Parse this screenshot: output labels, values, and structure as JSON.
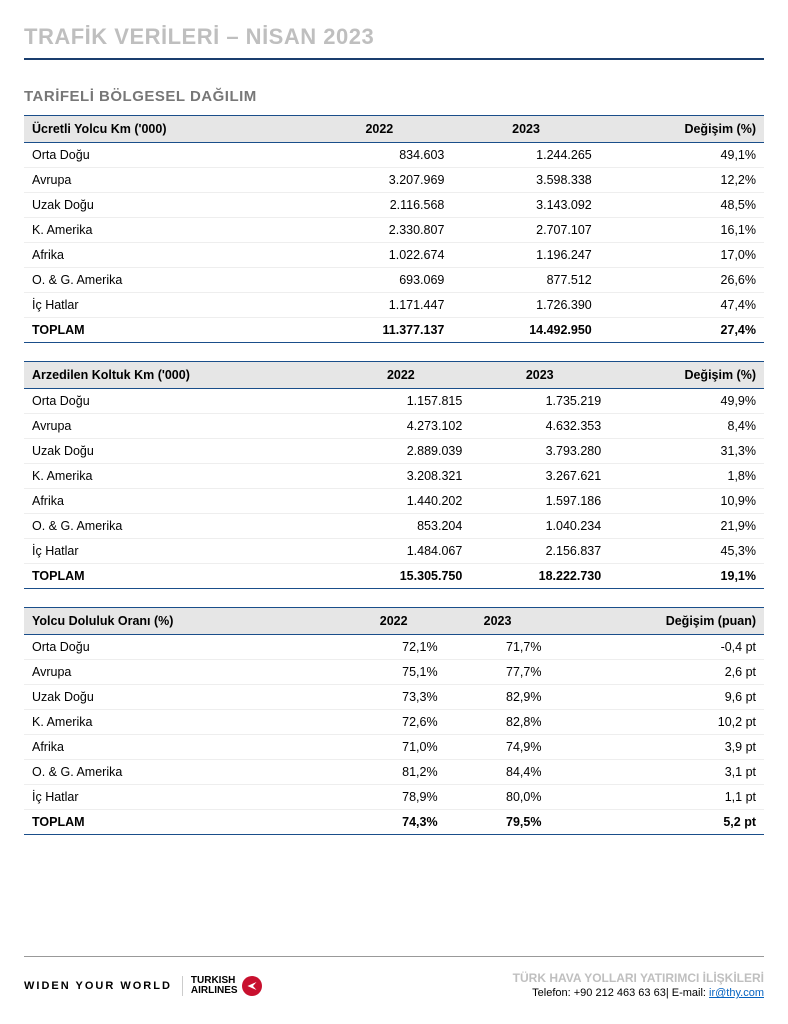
{
  "page": {
    "title": "TRAFİK VERİLERİ – NİSAN 2023",
    "section_title": "TARİFELİ BÖLGESEL DAĞILIM"
  },
  "tables": [
    {
      "headers": [
        "Ücretli Yolcu Km ('000)",
        "2022",
        "2023",
        "Değişim (%)"
      ],
      "rows": [
        [
          "Orta Doğu",
          "834.603",
          "1.244.265",
          "49,1%"
        ],
        [
          "Avrupa",
          "3.207.969",
          "3.598.338",
          "12,2%"
        ],
        [
          "Uzak Doğu",
          "2.116.568",
          "3.143.092",
          "48,5%"
        ],
        [
          "K. Amerika",
          "2.330.807",
          "2.707.107",
          "16,1%"
        ],
        [
          "Afrika",
          "1.022.674",
          "1.196.247",
          "17,0%"
        ],
        [
          "O. & G. Amerika",
          "693.069",
          "877.512",
          "26,6%"
        ],
        [
          "İç Hatlar",
          "1.171.447",
          "1.726.390",
          "47,4%"
        ]
      ],
      "total": [
        "TOPLAM",
        "11.377.137",
        "14.492.950",
        "27,4%"
      ]
    },
    {
      "headers": [
        "Arzedilen Koltuk Km ('000)",
        "2022",
        "2023",
        "Değişim (%)"
      ],
      "rows": [
        [
          "Orta Doğu",
          "1.157.815",
          "1.735.219",
          "49,9%"
        ],
        [
          "Avrupa",
          "4.273.102",
          "4.632.353",
          "8,4%"
        ],
        [
          "Uzak Doğu",
          "2.889.039",
          "3.793.280",
          "31,3%"
        ],
        [
          "K. Amerika",
          "3.208.321",
          "3.267.621",
          "1,8%"
        ],
        [
          "Afrika",
          "1.440.202",
          "1.597.186",
          "10,9%"
        ],
        [
          "O. & G. Amerika",
          "853.204",
          "1.040.234",
          "21,9%"
        ],
        [
          "İç Hatlar",
          "1.484.067",
          "2.156.837",
          "45,3%"
        ]
      ],
      "total": [
        "TOPLAM",
        "15.305.750",
        "18.222.730",
        "19,1%"
      ]
    },
    {
      "headers": [
        "Yolcu Doluluk Oranı (%)",
        "2022",
        "2023",
        "Değişim (puan)"
      ],
      "rows": [
        [
          "Orta Doğu",
          "72,1%",
          "71,7%",
          "-0,4 pt"
        ],
        [
          "Avrupa",
          "75,1%",
          "77,7%",
          "2,6 pt"
        ],
        [
          "Uzak Doğu",
          "73,3%",
          "82,9%",
          "9,6 pt"
        ],
        [
          "K. Amerika",
          "72,6%",
          "82,8%",
          "10,2 pt"
        ],
        [
          "Afrika",
          "71,0%",
          "74,9%",
          "3,9 pt"
        ],
        [
          "O. & G. Amerika",
          "81,2%",
          "84,4%",
          "3,1 pt"
        ],
        [
          "İç Hatlar",
          "78,9%",
          "80,0%",
          "1,1 pt"
        ]
      ],
      "total": [
        "TOPLAM",
        "74,3%",
        "79,5%",
        "5,2 pt"
      ]
    }
  ],
  "footer": {
    "widen": "WIDEN YOUR WORLD",
    "airline_line1": "TURKISH",
    "airline_line2": "AIRLINES",
    "dept": "TÜRK HAVA YOLLARI YATIRIMCI İLİŞKİLERİ",
    "phone_label": "Telefon:",
    "phone": "+90 212 463 63 63",
    "email_label": "E-mail:",
    "email": "ir@thy.com"
  }
}
